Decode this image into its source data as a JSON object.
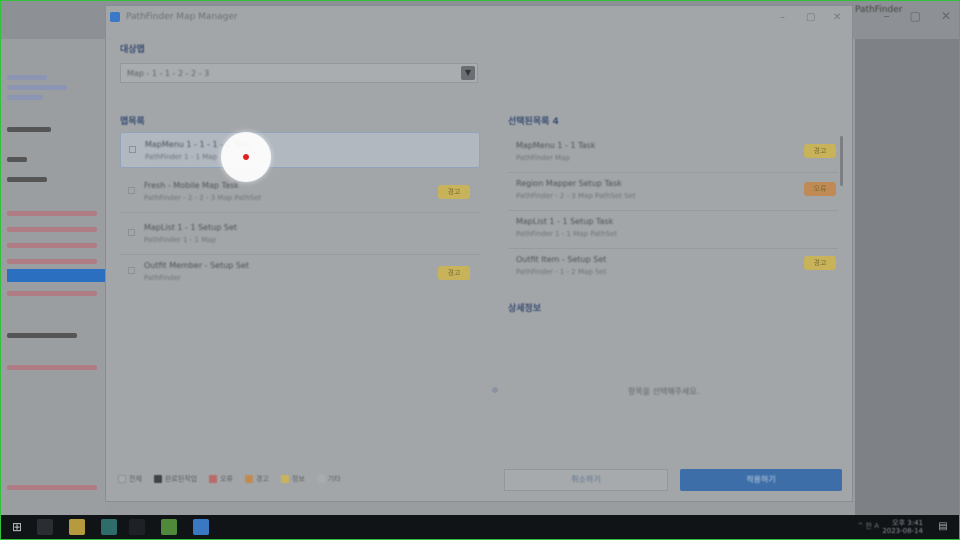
{
  "dialog": {
    "title": "PathFinder Map Manager",
    "controls": [
      "–",
      "▢",
      "✕"
    ]
  },
  "source": {
    "label": "대상맵",
    "selected_value": "Map - 1 - 1 - 2 - 2 - 3"
  },
  "left_panel": {
    "label": "맵목록",
    "items": [
      {
        "title": "MapMenu 1 - 1 - 1 - 2 Task",
        "sub": "PathFinder 1 - 1 Map",
        "badge": "",
        "badge_color": "",
        "selected": true
      },
      {
        "title": "Fresh - Mobile Map Task",
        "sub": "PathFinder - 2 - 2 - 3 Map PathSet",
        "badge": "경고",
        "badge_color": "yellow",
        "selected": false
      },
      {
        "title": "MapList 1 - 1 Setup Set",
        "sub": "PathFinder 1 - 1 Map",
        "badge": "",
        "badge_color": "",
        "selected": false
      },
      {
        "title": "Outfit Member - Setup Set",
        "sub": "PathFinder",
        "badge": "경고",
        "badge_color": "yellow",
        "selected": false
      }
    ]
  },
  "right_panel": {
    "label": "선택된목록 4",
    "items": [
      {
        "title": "MapMenu 1 - 1 Task",
        "sub": "PathFinder Map",
        "badge": "경고",
        "badge_color": "yellow"
      },
      {
        "title": "Region Mapper Setup Task",
        "sub": "PathFinder - 2 - 3 Map PathSet Set",
        "badge": "오류",
        "badge_color": "orange"
      },
      {
        "title": "MapList 1 - 1 Setup Task",
        "sub": "PathFinder 1 - 1 Map PathSet",
        "badge": "",
        "badge_color": ""
      },
      {
        "title": "Outfit Item - Setup Set",
        "sub": "PathFinder - 1 - 2 Map Set",
        "badge": "경고",
        "badge_color": "yellow"
      }
    ],
    "detail_label": "상세정보",
    "status_note": "항목을 선택해주세요."
  },
  "legend": [
    {
      "label": "전체",
      "color": "#a9acaf"
    },
    {
      "label": "완료된작업",
      "color": "#3f4347"
    },
    {
      "label": "오류",
      "color": "#b86b68"
    },
    {
      "label": "경고",
      "color": "#c08a55"
    },
    {
      "label": "정보",
      "color": "#c8b35a"
    },
    {
      "label": "기타",
      "color": "#a9acaf"
    }
  ],
  "buttons": {
    "cancel": "취소하기",
    "confirm": "적용하기"
  },
  "background_app": {
    "right_title": "PathFinder"
  },
  "taskbar": {
    "start_icon": "windows-icon",
    "tray_text": "^ 한 A",
    "clock_time": "오후 3:41",
    "clock_date": "2023-08-14"
  }
}
